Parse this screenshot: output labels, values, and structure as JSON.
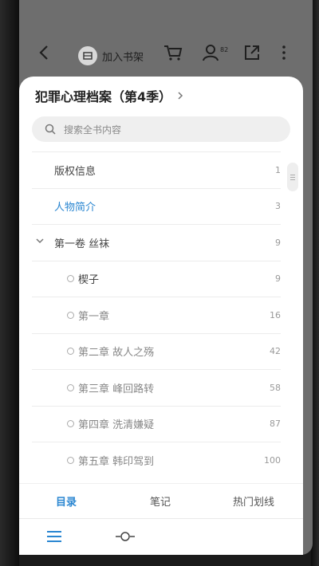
{
  "topbar": {
    "back_icon": "chevron-left-icon",
    "add_shelf_label": "加入书架",
    "badge_count": "82"
  },
  "sheet": {
    "book_title": "犯罪心理档案（第4季）",
    "search_placeholder": "搜索全书内容",
    "toc": [
      {
        "label": "版权信息",
        "page": "1",
        "level": 0
      },
      {
        "label": "人物简介",
        "page": "3",
        "level": 0,
        "active": true
      },
      {
        "label": "第一卷 丝袜",
        "page": "9",
        "level": 1,
        "expanded": true
      },
      {
        "label": "楔子",
        "page": "9",
        "level": 2
      },
      {
        "label": "第一章",
        "page": "16",
        "level": 2
      },
      {
        "label": "第二章 故人之殇",
        "page": "42",
        "level": 2
      },
      {
        "label": "第三章 峰回路转",
        "page": "58",
        "level": 2
      },
      {
        "label": "第四章 洗清嫌疑",
        "page": "87",
        "level": 2
      },
      {
        "label": "第五章 韩印驾到",
        "page": "100",
        "level": 2
      }
    ],
    "tabs": [
      "目录",
      "笔记",
      "热门划线"
    ],
    "active_tab": "目录"
  },
  "colors": {
    "accent": "#2a86d1",
    "overlay": "#6e6e6e"
  }
}
